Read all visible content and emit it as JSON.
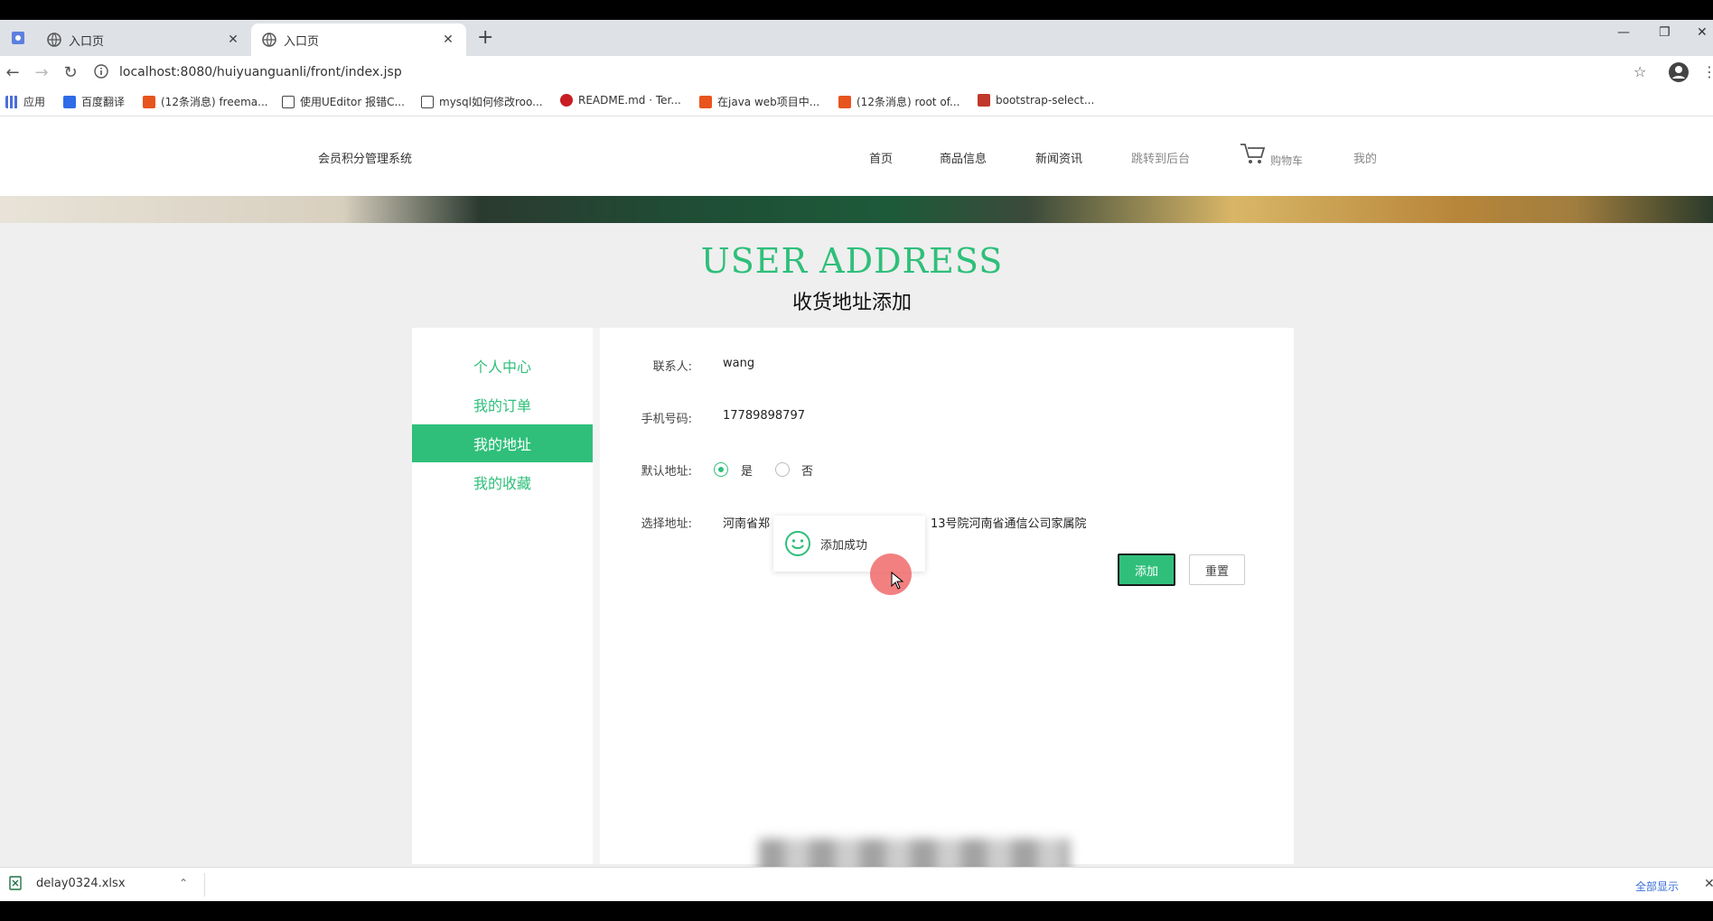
{
  "browser": {
    "tabs": [
      {
        "title": "入口页",
        "active": false
      },
      {
        "title": "入口页",
        "active": true
      }
    ],
    "url": "localhost:8080/huiyuanguanli/front/index.jsp",
    "bookmarks": [
      {
        "label": "应用",
        "icon": "apps-grid-icon",
        "color": "#4a6fd8"
      },
      {
        "label": "百度翻译",
        "icon": "baidu-translate-icon",
        "color": "#2e6be6"
      },
      {
        "label": "(12条消息) freema...",
        "icon": "csdn-icon",
        "color": "#e8541e"
      },
      {
        "label": "使用UEditor 报错C...",
        "icon": "ueditor-icon",
        "color": "#444444"
      },
      {
        "label": "mysql如何修改roo...",
        "icon": "mysql-icon",
        "color": "#444444"
      },
      {
        "label": "README.md · Ter...",
        "icon": "gitee-icon",
        "color": "#c71d23"
      },
      {
        "label": "在java web项目中...",
        "icon": "csdn-icon",
        "color": "#e8541e"
      },
      {
        "label": "(12条消息) root of...",
        "icon": "csdn-icon",
        "color": "#e8541e"
      },
      {
        "label": "bootstrap-select...",
        "icon": "bootstrap-icon",
        "color": "#c0392b"
      }
    ]
  },
  "site": {
    "brand": "会员积分管理系统",
    "nav": [
      {
        "label": "首页"
      },
      {
        "label": "商品信息"
      },
      {
        "label": "新闻资讯"
      },
      {
        "label": "跳转到后台"
      },
      {
        "label": "购物车"
      },
      {
        "label": "我的"
      }
    ],
    "accent_color": "#2fbf7a"
  },
  "hero": {
    "title_en": "USER ADDRESS",
    "title_cn": "收货地址添加"
  },
  "sidebar": {
    "items": [
      {
        "label": "个人中心",
        "active": false
      },
      {
        "label": "我的订单",
        "active": false
      },
      {
        "label": "我的地址",
        "active": true
      },
      {
        "label": "我的收藏",
        "active": false
      }
    ]
  },
  "form": {
    "contact_label": "联系人:",
    "contact_value": "wang",
    "phone_label": "手机号码:",
    "phone_value": "17789898797",
    "default_label": "默认地址:",
    "default_yes": "是",
    "default_no": "否",
    "default_selected": "是",
    "address_label": "选择地址:",
    "address_value_left": "河南省郑",
    "address_value_right": "13号院河南省通信公司家属院",
    "submit_label": "添加",
    "reset_label": "重置"
  },
  "toast": {
    "message": "添加成功"
  },
  "downloads": {
    "file_name": "delay0324.xlsx",
    "show_all": "全部显示"
  }
}
